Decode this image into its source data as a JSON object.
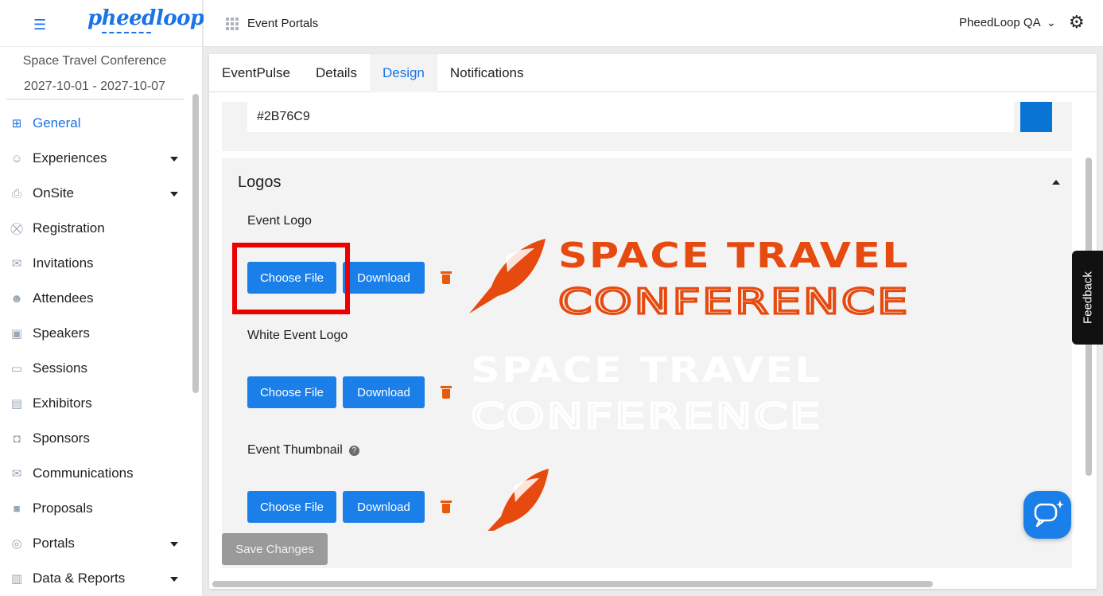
{
  "brand": {
    "logo_text": "pheedloop"
  },
  "sidebar": {
    "event_name": "Space Travel Conference",
    "event_dates": "2027-10-01 - 2027-10-07",
    "items": [
      {
        "label": "General",
        "icon": "grid-icon",
        "active": true,
        "expandable": false
      },
      {
        "label": "Experiences",
        "icon": "person-icon",
        "active": false,
        "expandable": true
      },
      {
        "label": "OnSite",
        "icon": "printer-icon",
        "active": false,
        "expandable": true
      },
      {
        "label": "Registration",
        "icon": "cart-icon",
        "active": false,
        "expandable": false
      },
      {
        "label": "Invitations",
        "icon": "mail-icon",
        "active": false,
        "expandable": false
      },
      {
        "label": "Attendees",
        "icon": "people-icon",
        "active": false,
        "expandable": false
      },
      {
        "label": "Speakers",
        "icon": "presenter-icon",
        "active": false,
        "expandable": false
      },
      {
        "label": "Sessions",
        "icon": "laptop-icon",
        "active": false,
        "expandable": false
      },
      {
        "label": "Exhibitors",
        "icon": "storefront-icon",
        "active": false,
        "expandable": false
      },
      {
        "label": "Sponsors",
        "icon": "badge-icon",
        "active": false,
        "expandable": false
      },
      {
        "label": "Communications",
        "icon": "mail-icon",
        "active": false,
        "expandable": false
      },
      {
        "label": "Proposals",
        "icon": "document-icon",
        "active": false,
        "expandable": false
      },
      {
        "label": "Portals",
        "icon": "globe-icon",
        "active": false,
        "expandable": true
      },
      {
        "label": "Data & Reports",
        "icon": "chart-icon",
        "active": false,
        "expandable": true
      }
    ]
  },
  "header": {
    "title": "Event Portals",
    "account": "PheedLoop QA"
  },
  "tabs": [
    {
      "label": "EventPulse",
      "active": false
    },
    {
      "label": "Details",
      "active": false
    },
    {
      "label": "Design",
      "active": true
    },
    {
      "label": "Notifications",
      "active": false
    }
  ],
  "design": {
    "primary_color": {
      "value": "#2B76C9",
      "swatch": "#0a74d4"
    },
    "logos": {
      "title": "Logos",
      "fields": [
        {
          "label": "Event Logo",
          "choose": "Choose File",
          "download": "Download",
          "has_help": false
        },
        {
          "label": "White Event Logo",
          "choose": "Choose File",
          "download": "Download",
          "has_help": false
        },
        {
          "label": "Event Thumbnail",
          "choose": "Choose File",
          "download": "Download",
          "has_help": true
        }
      ]
    },
    "save_label": "Save Changes"
  },
  "colors": {
    "accent": "#1a7fe8",
    "highlight": "#ef0000",
    "logo_orange": "#e64a0f"
  },
  "feedback_label": "Feedback"
}
